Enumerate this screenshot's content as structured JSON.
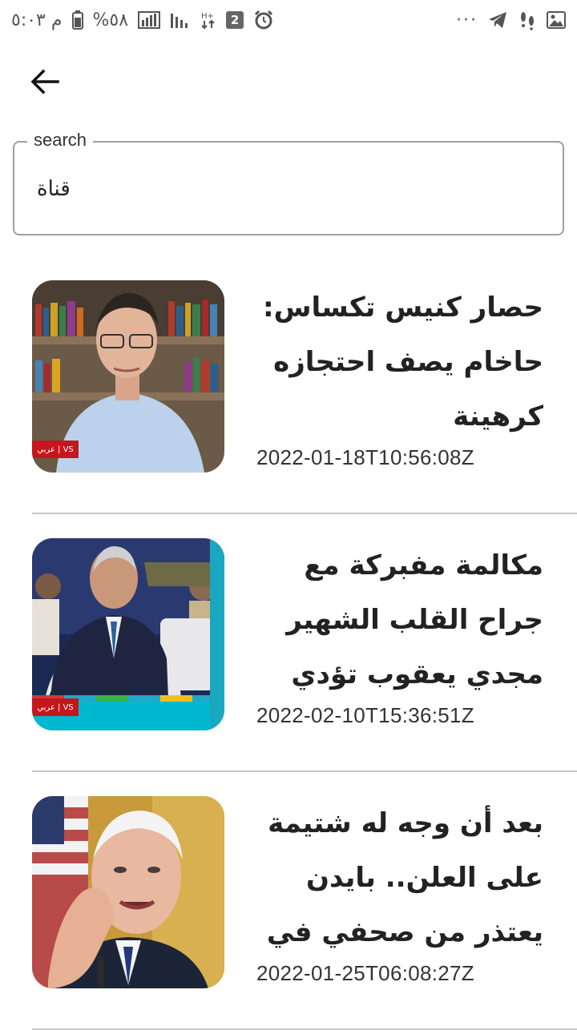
{
  "status_bar": {
    "time": "م ٥:٠٣",
    "battery": "%٥٨",
    "sim_badge": "2",
    "more": "···"
  },
  "search": {
    "label": "search",
    "value": "قناة"
  },
  "articles": [
    {
      "title": "حصار كنيس تكساس: حاخام يصف احتجازه كرهينة",
      "date": "2022-01-18T10:56:08Z",
      "tag": "عربي | VS"
    },
    {
      "title": "مكالمة مفبركة مع جراح القلب الشهير مجدي يعقوب تؤدي لوقف ...",
      "date": "2022-02-10T15:36:51Z",
      "tag": "عربي | VS"
    },
    {
      "title": "بعد أن وجه له شتيمة على العلن.. بايدن يعتذر من صحفي في \"فوكس...",
      "date": "2022-01-25T06:08:27Z"
    }
  ],
  "colors": {
    "divider": "#c8c8c8",
    "field_border": "#a0a0a0",
    "tag_red": "#c4161c"
  }
}
